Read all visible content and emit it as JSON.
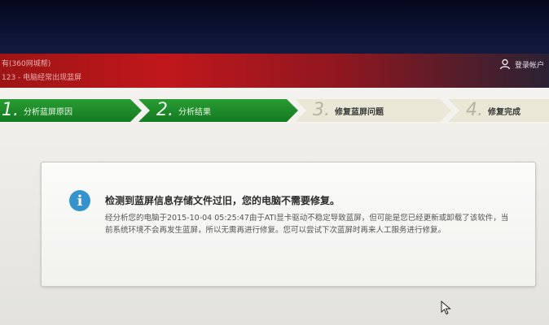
{
  "header": {
    "line1": "有(360网城帮)",
    "line2": "123 - 电脑经常出现蓝屏",
    "login_label": "登录帐户"
  },
  "steps": [
    {
      "num": "1.",
      "label": "分析蓝屏原因",
      "state": "done"
    },
    {
      "num": "2.",
      "label": "分析结果",
      "state": "done"
    },
    {
      "num": "3.",
      "label": "修复蓝屏问题",
      "state": "todo"
    },
    {
      "num": "4.",
      "label": "修复完成",
      "state": "todo"
    }
  ],
  "dialog": {
    "title": "检测到蓝屏信息存储文件过旧，您的电脑不需要修复。",
    "description": "经分析您的电脑于2015-10-04 05:25:47由于ATI显卡驱动不稳定导致蓝屏，但可能是您已经更新或卸载了该软件，当前系统环境不会再发生蓝屏，所以无需再进行修复。您可以尝试下次蓝屏时再来人工服务进行修复。"
  },
  "colors": {
    "accent_green": "#1e8a2a",
    "header_red": "#c0171c",
    "info_blue": "#3493cc"
  }
}
